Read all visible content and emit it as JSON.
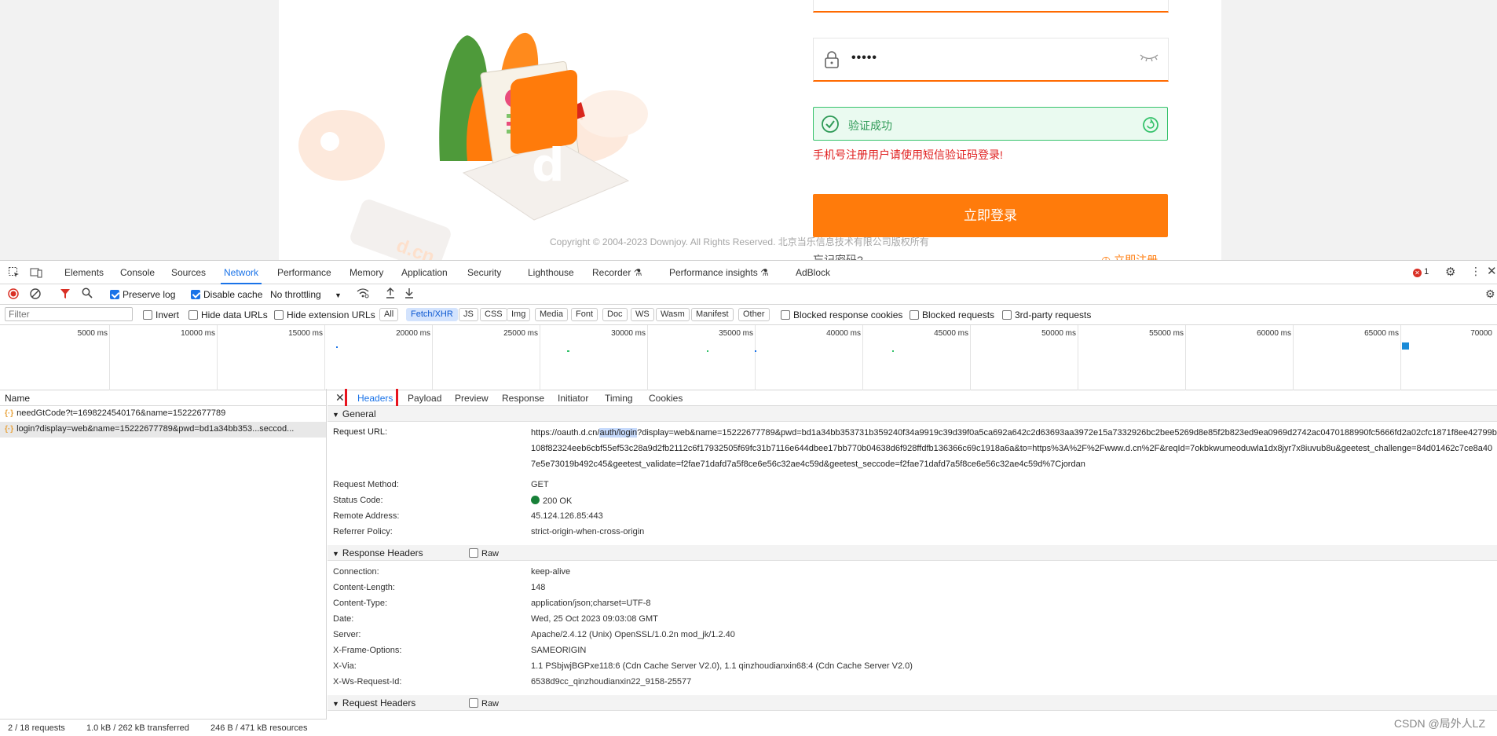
{
  "webpage": {
    "password_mask": "•••••",
    "verify_text": "验证成功",
    "warning": "手机号注册用户请使用短信验证码登录!",
    "login_button": "立即登录",
    "copyright": "Copyright © 2004-2023 Downjoy. All Rights Reserved. 北京当乐信息技术有限公司版权所有",
    "forgot": "忘记密码?",
    "register": "立即注册",
    "logo_letter": "d",
    "illus_text": "d.cn"
  },
  "devtools": {
    "tabs": [
      "Elements",
      "Console",
      "Sources",
      "Network",
      "Performance",
      "Memory",
      "Application",
      "Security",
      "Lighthouse",
      "Recorder",
      "Performance insights",
      "AdBlock"
    ],
    "active_tab": "Network",
    "error_count": "1",
    "toolbar": {
      "preserve_log": "Preserve log",
      "disable_cache": "Disable cache",
      "throttling": "No throttling"
    },
    "filter": {
      "placeholder": "Filter",
      "invert": "Invert",
      "hide_data_urls": "Hide data URLs",
      "hide_ext_urls": "Hide extension URLs",
      "types": [
        "All",
        "Fetch/XHR",
        "JS",
        "CSS",
        "Img",
        "Media",
        "Font",
        "Doc",
        "WS",
        "Wasm",
        "Manifest",
        "Other"
      ],
      "selected_type": "Fetch/XHR",
      "blocked_cookies": "Blocked response cookies",
      "blocked_requests": "Blocked requests",
      "third_party": "3rd-party requests"
    },
    "timeline_labels": [
      "5000 ms",
      "10000 ms",
      "15000 ms",
      "20000 ms",
      "25000 ms",
      "30000 ms",
      "35000 ms",
      "40000 ms",
      "45000 ms",
      "50000 ms",
      "55000 ms",
      "60000 ms",
      "65000 ms",
      "70000"
    ],
    "name_header": "Name",
    "requests": [
      "needGtCode?t=1698224540176&name=15222677789",
      "login?display=web&name=15222677789&pwd=bd1a34bb353...seccod..."
    ],
    "detail_tabs": [
      "Headers",
      "Payload",
      "Preview",
      "Response",
      "Initiator",
      "Timing",
      "Cookies"
    ],
    "general": {
      "title": "General",
      "request_url_label": "Request URL:",
      "request_url_prefix": "https://oauth.d.cn/",
      "request_url_selected": "auth/login",
      "request_url_rest": "?display=web&name=15222677789&pwd=bd1a34bb353731b359240f34a9919c39d39f0a5ca692a642c2d63693aa3972e15a7332926bc2bee5269d8e85f2b823ed9ea0969d2742ac0470188990fc5666fd2a02cfc1871f8ee42799b108f82324eeb6cbf55ef53c28a9d2fb2112c6f17932505f69fc31b7116e644dbee17bb770b04638d6f928ffdfb136366c69c1918a6a&to=https%3A%2F%2Fwww.d.cn%2F&reqId=7okbkwumeoduwla1dx8jyr7x8iuvub8u&geetest_challenge=84d01462c7ce8a407e5e73019b492c45&geetest_validate=f2fae71dafd7a5f8ce6e56c32ae4c59d&geetest_seccode=f2fae71dafd7a5f8ce6e56c32ae4c59d%7Cjordan",
      "rows": [
        {
          "k": "Request Method:",
          "v": "GET"
        },
        {
          "k": "Status Code:",
          "v": "200 OK"
        },
        {
          "k": "Remote Address:",
          "v": "45.124.126.85:443"
        },
        {
          "k": "Referrer Policy:",
          "v": "strict-origin-when-cross-origin"
        }
      ]
    },
    "response_headers": {
      "title": "Response Headers",
      "raw": "Raw",
      "rows": [
        {
          "k": "Connection:",
          "v": "keep-alive"
        },
        {
          "k": "Content-Length:",
          "v": "148"
        },
        {
          "k": "Content-Type:",
          "v": "application/json;charset=UTF-8"
        },
        {
          "k": "Date:",
          "v": "Wed, 25 Oct 2023 09:03:08 GMT"
        },
        {
          "k": "Server:",
          "v": "Apache/2.4.12 (Unix) OpenSSL/1.0.2n mod_jk/1.2.40"
        },
        {
          "k": "X-Frame-Options:",
          "v": "SAMEORIGIN"
        },
        {
          "k": "X-Via:",
          "v": "1.1 PSbjwjBGPxe118:6 (Cdn Cache Server V2.0), 1.1 qinzhoudianxin68:4 (Cdn Cache Server V2.0)"
        },
        {
          "k": "X-Ws-Request-Id:",
          "v": "6538d9cc_qinzhoudianxin22_9158-25577"
        }
      ]
    },
    "request_headers": {
      "title": "Request Headers",
      "raw": "Raw"
    },
    "status": {
      "requests": "2 / 18 requests",
      "transferred": "1.0 kB / 262 kB transferred",
      "resources": "246 B / 471 kB resources"
    }
  },
  "watermark": "CSDN @局外人LZ",
  "colors": {
    "accent": "#ff7b0b",
    "devtools_blue": "#1a73e8",
    "success_green": "#35c26b",
    "error_red": "#e02020",
    "highlight_red": "#e8141e"
  }
}
